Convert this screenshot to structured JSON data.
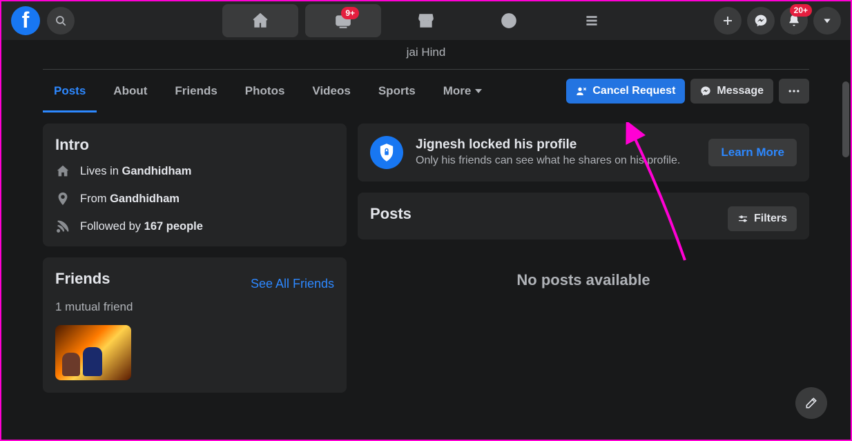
{
  "topnav": {
    "watch_badge": "9+",
    "notif_badge": "20+"
  },
  "profile": {
    "bio": "jai Hind"
  },
  "tabs": {
    "posts": "Posts",
    "about": "About",
    "friends": "Friends",
    "photos": "Photos",
    "videos": "Videos",
    "sports": "Sports",
    "more": "More"
  },
  "actions": {
    "cancel_request": "Cancel Request",
    "message": "Message"
  },
  "intro": {
    "heading": "Intro",
    "lives_prefix": "Lives in ",
    "lives_city": "Gandhidham",
    "from_prefix": "From ",
    "from_city": "Gandhidham",
    "followed_prefix": "Followed by ",
    "followed_count": "167 people"
  },
  "locked": {
    "title": "Jignesh locked his profile",
    "subtitle": "Only his friends can see what he shares on his profile.",
    "learn_more": "Learn More"
  },
  "posts_section": {
    "heading": "Posts",
    "filters": "Filters",
    "empty": "No posts available"
  },
  "friends": {
    "heading": "Friends",
    "see_all": "See All Friends",
    "mutual": "1 mutual friend"
  }
}
